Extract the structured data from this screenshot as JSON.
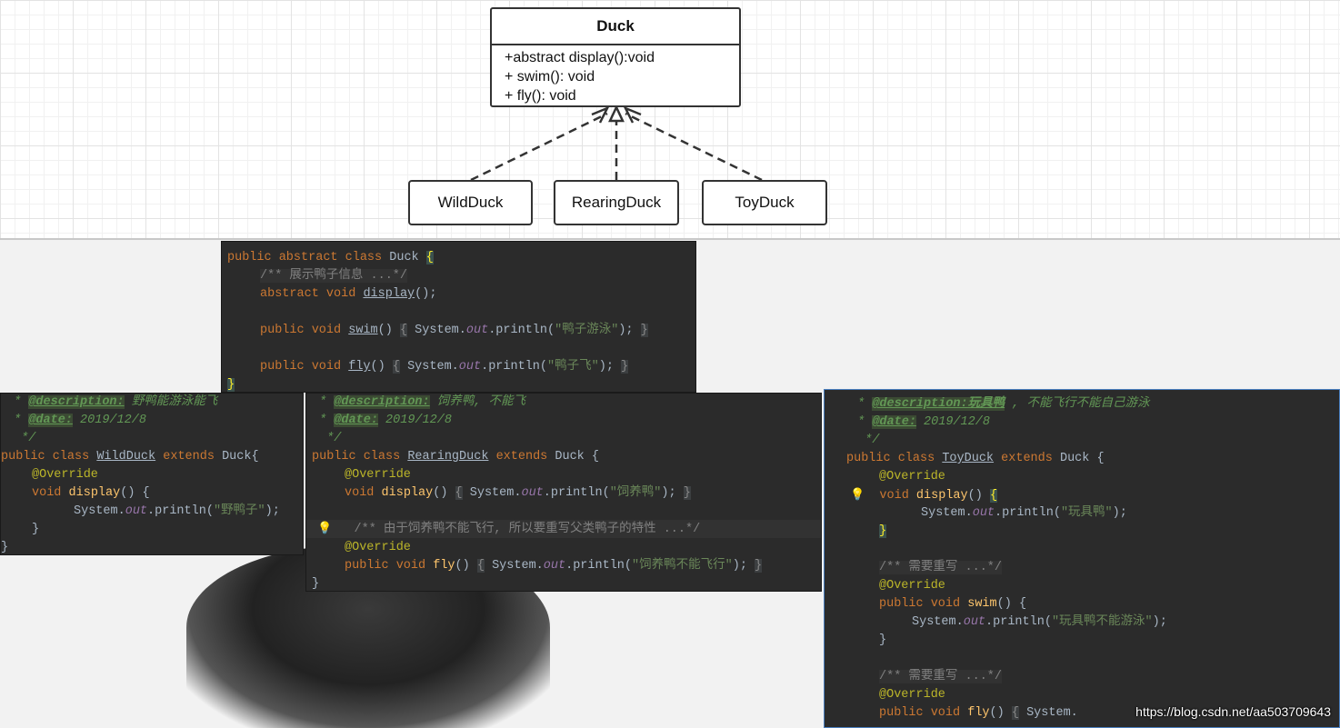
{
  "uml": {
    "class_name": "Duck",
    "operations": [
      "+abstract display():void",
      "+ swim(): void",
      "+ fly(): void"
    ],
    "subclasses": [
      "WildDuck",
      "RearingDuck",
      "ToyDuck"
    ]
  },
  "code": {
    "duck": [
      "public abstract class Duck {",
      "/** 展示鸭子信息 ...*/",
      "abstract void display();",
      "public void swim() { System.out.println(\"鸭子游泳\"); }",
      "public void fly() { System.out.println(\"鸭子飞\"); }",
      "}"
    ],
    "wild": {
      "desc_tag": "@description:",
      "desc": "野鸭能游泳能飞",
      "date_tag": "@date:",
      "date": "2019/12/8",
      "end_comment": "*/",
      "class_line_kw": "public class",
      "class_name": "WildDuck",
      "extends_kw": "extends",
      "parent": "Duck{",
      "override": "@Override",
      "method": "display",
      "println_pre": "System.",
      "out": "out",
      "println_mid": ".println(",
      "string": "\"野鸭子\"",
      "println_end": ");"
    },
    "rear": {
      "desc_tag": "@description:",
      "desc": "饲养鸭, 不能飞",
      "date_tag": "@date:",
      "date": "2019/12/8",
      "class_name": "RearingDuck",
      "display_string": "\"饲养鸭\"",
      "comment": "/** 由于饲养鸭不能飞行, 所以要重写父类鸭子的特性 ...*/",
      "fly_string": "\"饲养鸭不能飞行\""
    },
    "toy": {
      "desc_tag": "@description:玩具鸭",
      "desc": " , 不能飞行不能自己游泳",
      "date_tag": "@date:",
      "date": "2019/12/8",
      "class_name": "ToyDuck",
      "display_string": "\"玩具鸭\"",
      "comment1": "/** 需要重写 ...*/",
      "swim_string": "\"玩具鸭不能游泳\"",
      "comment2": "/** 需要重写 ...*/"
    }
  },
  "watermark": "https://blog.csdn.net/aa503709643"
}
